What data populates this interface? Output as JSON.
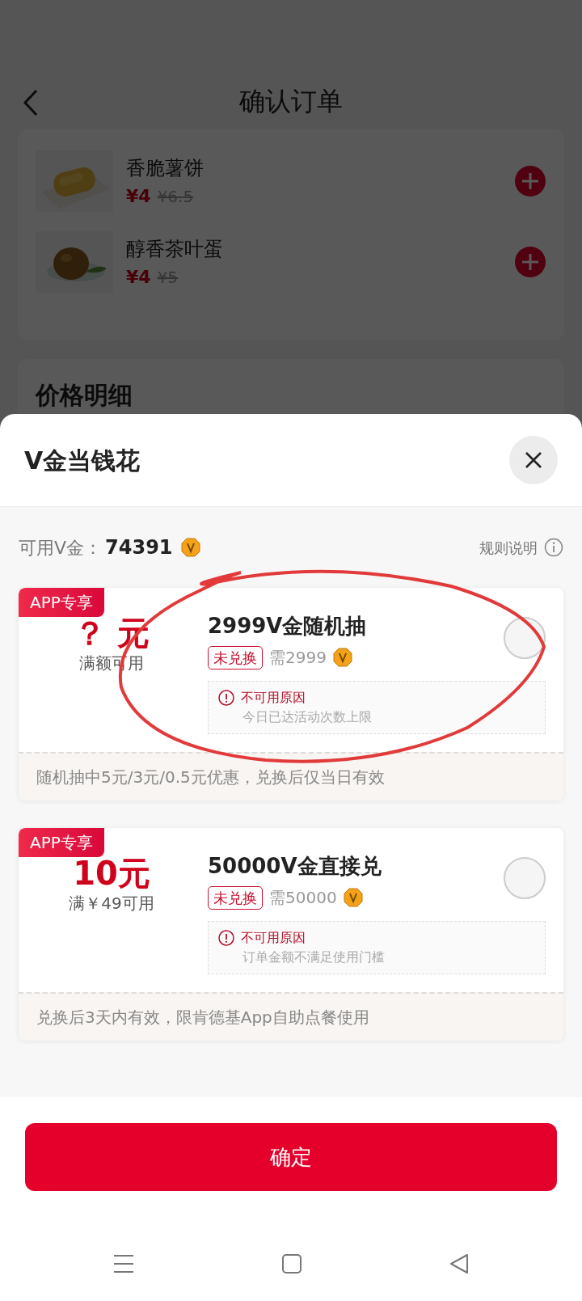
{
  "background_page": {
    "title": "确认订单",
    "items": [
      {
        "name": "香脆薯饼",
        "price": "¥4",
        "original_price": "¥6.5",
        "kind": "hashbrown"
      },
      {
        "name": "醇香茶叶蛋",
        "price": "¥4",
        "original_price": "¥5",
        "kind": "egg"
      }
    ],
    "section_title": "价格明细"
  },
  "sheet": {
    "title": "V金当钱花",
    "balance_label": "可用V金：",
    "balance": "74391",
    "rules_link": "规则说明"
  },
  "coupons": [
    {
      "tag": "APP专享",
      "amount": "？ 元",
      "condition": "满额可用",
      "title": "2999V金随机抽",
      "status": "未兑换",
      "cost": "需2999",
      "selected": false,
      "reason_title": "不可用原因",
      "reason": "今日已达活动次数上限",
      "note": "随机抽中5元/3元/0.5元优惠，兑换后仅当日有效"
    },
    {
      "tag": "APP专享",
      "amount": "10元",
      "condition": "满￥49可用",
      "title": "50000V金直接兑",
      "status": "未兑换",
      "cost": "需50000",
      "selected": false,
      "reason_title": "不可用原因",
      "reason": "订单金额不满足使用门槛",
      "note": "兑换后3天内有效，限肯德基App自助点餐使用"
    }
  ],
  "confirm_button": "确定"
}
